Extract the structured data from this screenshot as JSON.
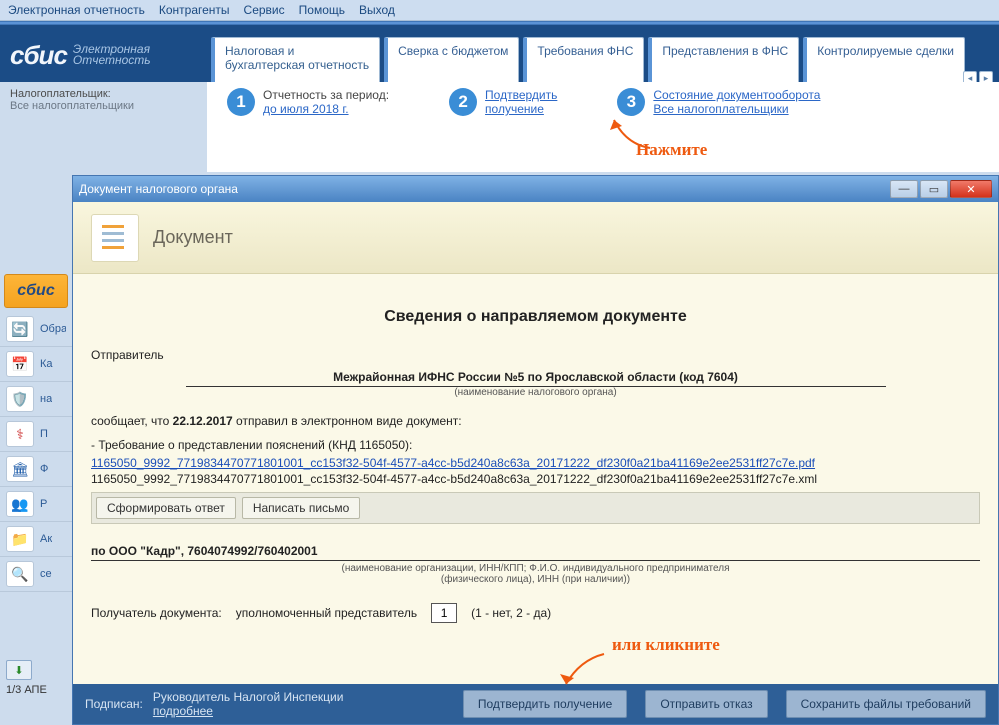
{
  "menu": {
    "m1": "Электронная отчетность",
    "m2": "Контрагенты",
    "m3": "Сервис",
    "m4": "Помощь",
    "m5": "Выход"
  },
  "logo": {
    "main": "сбис",
    "sub1": "Электронная",
    "sub2": "Отчетность"
  },
  "tabs": {
    "t1": "Налоговая и\nбухгалтерская отчетность",
    "t2": "Сверка с бюджетом",
    "t3": "Требования ФНС",
    "t4": "Представления в ФНС",
    "t5": "Контролируемые сделки"
  },
  "side": {
    "label": "Налогоплательщик:",
    "value": "Все налогоплательщики"
  },
  "steps": {
    "s1a": "Отчетность за период:",
    "s1b": "до июля 2018 г.",
    "s2a": "Подтвердить",
    "s2b": "получение",
    "s3a": "Состояние документооборота",
    "s3b": "Все налогоплательщики"
  },
  "annots": {
    "a1": "Нажмите",
    "a2": "или кликните"
  },
  "lrow": {
    "ob": "Обра",
    "ka": "Ка",
    "na": "на",
    "p": "П",
    "f": "Ф",
    "r": "Р",
    "ak": "Ак",
    "se": "се"
  },
  "frac": "1/3 АПЕ",
  "modal": {
    "titlebar": "Документ налогового органа",
    "head": "Документ",
    "h3": "Сведения о направляемом документе",
    "sender": "Отправитель",
    "authority": "Межрайонная ИФНС России №5 по Ярославской области (код 7604)",
    "authcap": "(наименование налогового органа)",
    "msg_pre": "сообщает, что ",
    "msg_date": "22.12.2017",
    "msg_post": " отправил в электронном виде документ:",
    "req": "-  Требование о представлении пояснений (КНД 1165050):",
    "pdf": "1165050_9992_771983447077180100​1_cc153f32-504f-4577-a4cc-b5d240a8c63a_20171222_df230f0a21ba41169e2ee2531ff27c7e.pdf",
    "xml": "1165050_9992_771983447077180100​1_cc153f32-504f-4577-a4cc-b5d240a8c63a_20171222_df230f0a21ba41169e2ee2531ff27c7e.xml",
    "b1": "Сформировать ответ",
    "b2": "Написать письмо",
    "org": "по  ООО \"Кадр\", 7604074992/760402001",
    "orgcap": "(наименование организации, ИНН/КПП; Ф.И.О. индивидуального предпринимателя\n(физического лица), ИНН (при наличии))",
    "recv_lbl": "Получатель документа:",
    "recv_val": "уполномоченный представитель",
    "recv_box": "1",
    "recv_hint": "(1 - нет, 2 - да)",
    "signed_lbl": "Подписан:",
    "signed_val": "Руководитель Налогой Инспекции",
    "more": "подробнее",
    "f1": "Подтвердить получение",
    "f2": "Отправить отказ",
    "f3": "Сохранить файлы требований"
  }
}
